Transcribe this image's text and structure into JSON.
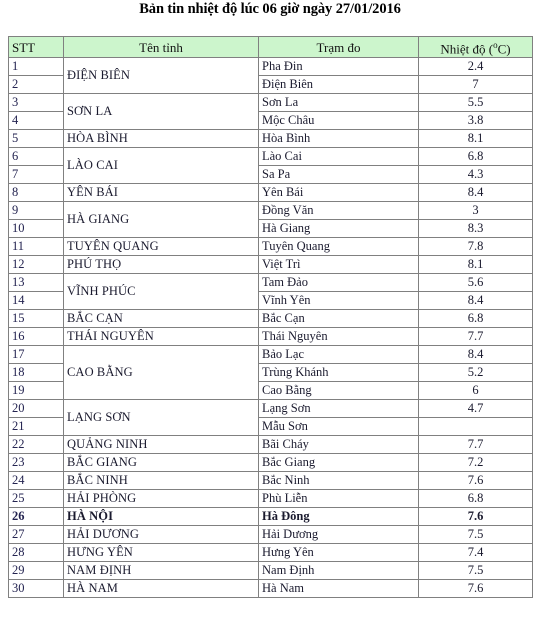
{
  "document": {
    "title": "Bản tin nhiệt độ lúc 06 giờ ngày 27/01/2016",
    "colors": {
      "header_background": "#ccf5cc",
      "header_border": "#2e7d32",
      "grid_border": "#808080",
      "text": "#1a1a2e"
    }
  },
  "table": {
    "columns": [
      {
        "key": "stt",
        "label": "STT"
      },
      {
        "key": "tinh",
        "label": "Tên tỉnh"
      },
      {
        "key": "tram",
        "label": "Trạm đo"
      },
      {
        "key": "nhiet",
        "label": "Nhiệt độ (",
        "unit_sup": "o",
        "unit_tail": "C)"
      }
    ],
    "rows": [
      {
        "stt": "1",
        "tinh": "ĐIỆN BIÊN",
        "tinh_rowspan": 2,
        "tram": "Pha Đin",
        "nhiet": "2.4",
        "bold": false
      },
      {
        "stt": "2",
        "tinh": null,
        "tinh_rowspan": 0,
        "tram": "Điện Biên",
        "nhiet": "7",
        "bold": false
      },
      {
        "stt": "3",
        "tinh": "SƠN LA",
        "tinh_rowspan": 2,
        "tram": "Sơn La",
        "nhiet": "5.5",
        "bold": false
      },
      {
        "stt": "4",
        "tinh": null,
        "tinh_rowspan": 0,
        "tram": "Mộc Châu",
        "nhiet": "3.8",
        "bold": false
      },
      {
        "stt": "5",
        "tinh": "HÒA BÌNH",
        "tinh_rowspan": 1,
        "tram": "Hòa Bình",
        "nhiet": "8.1",
        "bold": false
      },
      {
        "stt": "6",
        "tinh": "LÀO CAI",
        "tinh_rowspan": 2,
        "tram": "Lào Cai",
        "nhiet": "6.8",
        "bold": false
      },
      {
        "stt": "7",
        "tinh": null,
        "tinh_rowspan": 0,
        "tram": "Sa Pa",
        "nhiet": "4.3",
        "bold": false
      },
      {
        "stt": "8",
        "tinh": "YÊN BÁI",
        "tinh_rowspan": 1,
        "tram": "Yên Bái",
        "nhiet": "8.4",
        "bold": false
      },
      {
        "stt": "9",
        "tinh": "HÀ GIANG",
        "tinh_rowspan": 2,
        "tram": "Đồng Văn",
        "nhiet": "3",
        "bold": false
      },
      {
        "stt": "10",
        "tinh": null,
        "tinh_rowspan": 0,
        "tram": "Hà Giang",
        "nhiet": "8.3",
        "bold": false
      },
      {
        "stt": "11",
        "tinh": "TUYÊN QUANG",
        "tinh_rowspan": 1,
        "tram": "Tuyên Quang",
        "nhiet": "7.8",
        "bold": false
      },
      {
        "stt": "12",
        "tinh": "PHÚ THỌ",
        "tinh_rowspan": 1,
        "tram": "Việt Trì",
        "nhiet": "8.1",
        "bold": false
      },
      {
        "stt": "13",
        "tinh": "VĨNH PHÚC",
        "tinh_rowspan": 2,
        "tram": "Tam Đảo",
        "nhiet": "5.6",
        "bold": false
      },
      {
        "stt": "14",
        "tinh": null,
        "tinh_rowspan": 0,
        "tram": "Vĩnh Yên",
        "nhiet": "8.4",
        "bold": false
      },
      {
        "stt": "15",
        "tinh": "BẮC CẠN",
        "tinh_rowspan": 1,
        "tram": "Bắc Cạn",
        "nhiet": "6.8",
        "bold": false
      },
      {
        "stt": "16",
        "tinh": "THÁI NGUYÊN",
        "tinh_rowspan": 1,
        "tram": "Thái Nguyên",
        "nhiet": "7.7",
        "bold": false
      },
      {
        "stt": "17",
        "tinh": "CAO BẰNG",
        "tinh_rowspan": 3,
        "tram": "Bảo Lạc",
        "nhiet": "8.4",
        "bold": false
      },
      {
        "stt": "18",
        "tinh": null,
        "tinh_rowspan": 0,
        "tram": "Trùng Khánh",
        "nhiet": "5.2",
        "bold": false
      },
      {
        "stt": "19",
        "tinh": null,
        "tinh_rowspan": 0,
        "tram": "Cao Bằng",
        "nhiet": "6",
        "bold": false
      },
      {
        "stt": "20",
        "tinh": "LẠNG SƠN",
        "tinh_rowspan": 2,
        "tram": "Lạng Sơn",
        "nhiet": "4.7",
        "bold": false
      },
      {
        "stt": "21",
        "tinh": null,
        "tinh_rowspan": 0,
        "tram": "Mẫu Sơn",
        "nhiet": "",
        "bold": false
      },
      {
        "stt": "22",
        "tinh": "QUẢNG NINH",
        "tinh_rowspan": 1,
        "tram": "Bãi Cháy",
        "nhiet": "7.7",
        "bold": false
      },
      {
        "stt": "23",
        "tinh": "BẮC GIANG",
        "tinh_rowspan": 1,
        "tram": "Bắc Giang",
        "nhiet": "7.2",
        "bold": false
      },
      {
        "stt": "24",
        "tinh": "BẮC NINH",
        "tinh_rowspan": 1,
        "tram": "Bắc Ninh",
        "nhiet": "7.6",
        "bold": false
      },
      {
        "stt": "25",
        "tinh": "HẢI PHÒNG",
        "tinh_rowspan": 1,
        "tram": "Phù Liễn",
        "nhiet": "6.8",
        "bold": false
      },
      {
        "stt": "26",
        "tinh": "HÀ NỘI",
        "tinh_rowspan": 1,
        "tram": "Hà Đông",
        "nhiet": "7.6",
        "bold": true
      },
      {
        "stt": "27",
        "tinh": "HẢI DƯƠNG",
        "tinh_rowspan": 1,
        "tram": "Hải Dương",
        "nhiet": "7.5",
        "bold": false
      },
      {
        "stt": "28",
        "tinh": "HƯNG YÊN",
        "tinh_rowspan": 1,
        "tram": "Hưng Yên",
        "nhiet": "7.4",
        "bold": false
      },
      {
        "stt": "29",
        "tinh": "NAM ĐỊNH",
        "tinh_rowspan": 1,
        "tram": "Nam Định",
        "nhiet": "7.5",
        "bold": false
      },
      {
        "stt": "30",
        "tinh": "HÀ NAM",
        "tinh_rowspan": 1,
        "tram": "Hà Nam",
        "nhiet": "7.6",
        "bold": false
      }
    ]
  }
}
